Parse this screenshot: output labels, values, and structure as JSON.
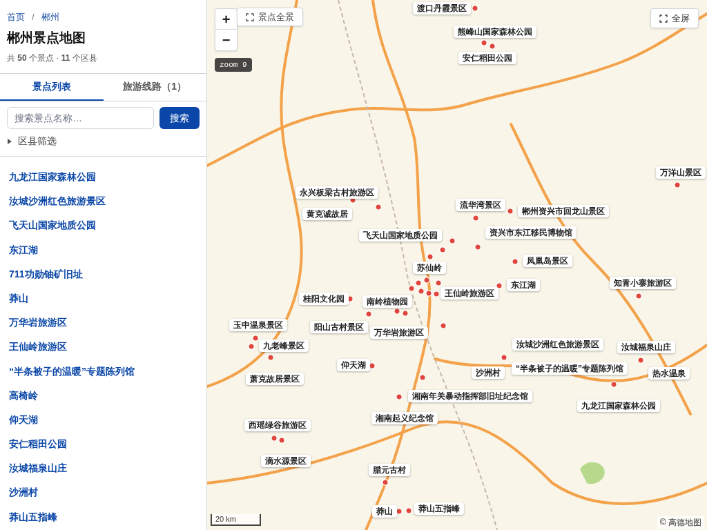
{
  "breadcrumb": [
    {
      "label": "首页"
    },
    {
      "label": "郴州"
    }
  ],
  "breadcrumb_separator": "/",
  "title": "郴州景点地图",
  "summary": "共 **50** 个景点 · **11** 个区县",
  "tabs": [
    {
      "label": "景点列表",
      "selected": true
    },
    {
      "label": "旅游线路（1）",
      "selected": false
    }
  ],
  "search": {
    "placeholder": "搜索景点名称…",
    "button": "搜索"
  },
  "filter": {
    "label": "区县筛选",
    "expanded": false
  },
  "spots": [
    "九龙江国家森林公园",
    "汝城沙洲红色旅游景区",
    "飞天山国家地质公园",
    "东江湖",
    "711功勋铀矿旧址",
    "莽山",
    "万华岩旅游区",
    "王仙岭旅游区",
    "“半条被子的温暖”专题陈列馆",
    "高椅岭",
    "仰天湖",
    "安仁稻田公园",
    "汝城福泉山庄",
    "沙洲村",
    "莽山五指峰"
  ],
  "map": {
    "zoom_in": "+",
    "zoom_out": "−",
    "overview_button": "景点全景",
    "fullscreen_button": "全屏",
    "zoom_badge": "zoom 9",
    "scale": "20 km",
    "attribution": "© 高德地图",
    "markers": [
      {
        "name": "渡口丹霞景区"
      },
      {
        "name": "熊峰山国家森林公园"
      },
      {
        "name": "安仁稻田公园"
      },
      {
        "name": "永兴板梁古村旅游区"
      },
      {
        "name": "黄克诚故居"
      },
      {
        "name": "流华湾景区"
      },
      {
        "name": "郴州资兴市回龙山景区"
      },
      {
        "name": "飞天山国家地质公园"
      },
      {
        "name": "资兴市东江移民博物馆"
      },
      {
        "name": "苏仙岭"
      },
      {
        "name": "凤凰岛景区"
      },
      {
        "name": "东江湖"
      },
      {
        "name": "王仙岭旅游区"
      },
      {
        "name": "知青小寨旅游区"
      },
      {
        "name": "万洋山景区"
      },
      {
        "name": "桂阳文化园"
      },
      {
        "name": "南岭植物园"
      },
      {
        "name": "玉中温泉景区"
      },
      {
        "name": "阳山古村景区"
      },
      {
        "name": "万华岩旅游区"
      },
      {
        "name": "九老峰景区"
      },
      {
        "name": "汝城沙洲红色旅游景区"
      },
      {
        "name": "汝城福泉山庄"
      },
      {
        "name": "仰天湖"
      },
      {
        "name": "沙洲村"
      },
      {
        "name": "“半条被子的温暖”专题陈列馆"
      },
      {
        "name": "热水温泉"
      },
      {
        "name": "萧克故居景区"
      },
      {
        "name": "湘南年关暴动指挥部旧址纪念馆"
      },
      {
        "name": "九龙江国家森林公园"
      },
      {
        "name": "湘南起义纪念馆"
      },
      {
        "name": "西瑶绿谷旅游区"
      },
      {
        "name": "滴水源景区"
      },
      {
        "name": "腊元古村"
      },
      {
        "name": "莽山五指峰"
      },
      {
        "name": "莽山"
      }
    ]
  }
}
